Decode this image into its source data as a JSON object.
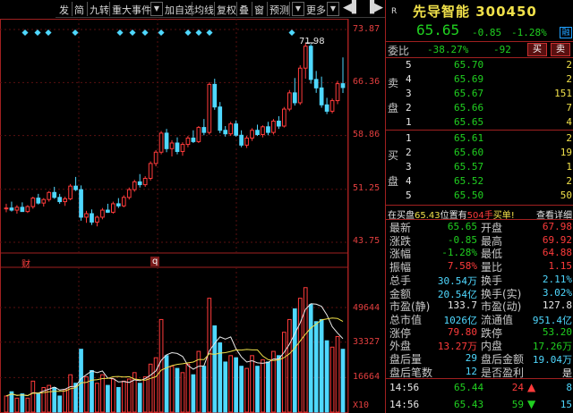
{
  "toolbar": {
    "items": [
      "发",
      "简",
      "九转",
      "重大事件",
      "加自选",
      "均线",
      "复权",
      "叠",
      "窗",
      "预测",
      "更多"
    ]
  },
  "chart": {
    "price_axis": [
      "73.87",
      "66.36",
      "58.86",
      "51.25",
      "43.75"
    ],
    "volume_axis": [
      "49644",
      "33327",
      "16664",
      "X10"
    ],
    "peak_label": "71.98",
    "markers": [
      "财",
      "q"
    ]
  },
  "chart_data": {
    "type": "candlestick",
    "ohlc": [
      [
        48.5,
        49.2,
        48.0,
        48.6
      ],
      [
        48.6,
        49.5,
        48.1,
        48.3
      ],
      [
        48.3,
        49.0,
        47.8,
        48.7
      ],
      [
        48.7,
        49.4,
        48.2,
        48.1
      ],
      [
        48.1,
        49.0,
        47.9,
        48.8
      ],
      [
        48.8,
        50.2,
        48.5,
        50.0
      ],
      [
        50.0,
        50.6,
        49.1,
        49.3
      ],
      [
        49.3,
        50.0,
        48.8,
        49.8
      ],
      [
        49.8,
        51.0,
        49.5,
        50.8
      ],
      [
        50.8,
        51.6,
        49.9,
        50.1
      ],
      [
        50.1,
        50.6,
        49.2,
        49.5
      ],
      [
        49.5,
        50.2,
        48.9,
        49.9
      ],
      [
        49.9,
        52.0,
        49.7,
        51.7
      ],
      [
        51.7,
        53.0,
        51.0,
        51.2
      ],
      [
        51.2,
        51.8,
        46.8,
        47.3
      ],
      [
        47.3,
        48.2,
        46.5,
        47.8
      ],
      [
        47.8,
        48.4,
        46.2,
        46.6
      ],
      [
        46.6,
        47.5,
        46.0,
        47.3
      ],
      [
        47.3,
        48.6,
        47.0,
        48.3
      ],
      [
        48.3,
        49.2,
        47.9,
        48.0
      ],
      [
        48.0,
        49.5,
        47.8,
        49.2
      ],
      [
        49.2,
        50.0,
        48.6,
        48.9
      ],
      [
        48.9,
        50.4,
        48.7,
        50.1
      ],
      [
        50.1,
        51.5,
        49.8,
        51.2
      ],
      [
        51.2,
        52.6,
        50.9,
        52.3
      ],
      [
        52.3,
        53.4,
        51.5,
        51.9
      ],
      [
        51.9,
        53.1,
        51.6,
        52.8
      ],
      [
        52.8,
        55.2,
        52.5,
        54.9
      ],
      [
        54.9,
        56.8,
        54.5,
        56.5
      ],
      [
        56.5,
        59.5,
        56.2,
        59.2
      ],
      [
        59.2,
        59.8,
        56.5,
        57.0
      ],
      [
        57.0,
        58.2,
        55.9,
        57.8
      ],
      [
        57.8,
        58.6,
        56.2,
        56.6
      ],
      [
        56.6,
        57.9,
        56.0,
        57.6
      ],
      [
        57.6,
        58.8,
        57.2,
        58.5
      ],
      [
        58.5,
        59.6,
        57.8,
        58.0
      ],
      [
        58.0,
        60.2,
        57.8,
        60.0
      ],
      [
        60.0,
        61.2,
        58.9,
        59.3
      ],
      [
        59.3,
        66.4,
        59.0,
        66.1
      ],
      [
        66.1,
        66.9,
        62.5,
        62.9
      ],
      [
        62.9,
        63.6,
        59.2,
        59.6
      ],
      [
        59.6,
        60.2,
        58.7,
        59.1
      ],
      [
        59.1,
        60.8,
        58.8,
        60.5
      ],
      [
        60.5,
        61.0,
        58.7,
        58.9
      ],
      [
        58.9,
        59.6,
        57.2,
        57.5
      ],
      [
        57.5,
        58.8,
        57.1,
        58.5
      ],
      [
        58.5,
        59.9,
        58.1,
        59.6
      ],
      [
        59.6,
        60.4,
        58.8,
        59.0
      ],
      [
        59.0,
        60.3,
        58.6,
        60.1
      ],
      [
        60.1,
        60.8,
        58.9,
        59.3
      ],
      [
        59.3,
        61.2,
        59.0,
        60.9
      ],
      [
        60.9,
        61.6,
        59.8,
        60.2
      ],
      [
        60.2,
        62.9,
        60.0,
        62.6
      ],
      [
        62.6,
        65.3,
        62.3,
        64.9
      ],
      [
        64.9,
        67.0,
        63.1,
        63.5
      ],
      [
        63.5,
        68.8,
        63.2,
        68.4
      ],
      [
        68.4,
        71.98,
        66.9,
        71.5
      ],
      [
        71.5,
        71.8,
        66.2,
        66.8
      ],
      [
        66.8,
        68.0,
        64.9,
        65.6
      ],
      [
        65.6,
        67.2,
        62.8,
        63.2
      ],
      [
        63.2,
        64.2,
        61.9,
        62.3
      ],
      [
        62.3,
        64.1,
        62.0,
        63.8
      ],
      [
        63.8,
        66.6,
        63.3,
        66.2
      ],
      [
        66.2,
        69.92,
        64.88,
        65.65
      ]
    ],
    "volume": [
      8,
      10,
      7,
      9,
      7,
      15,
      9,
      12,
      13,
      12,
      8,
      11,
      18,
      14,
      30,
      17,
      20,
      14,
      18,
      13,
      16,
      12,
      15,
      16,
      19,
      14,
      17,
      23,
      26,
      44,
      27,
      22,
      21,
      19,
      23,
      18,
      29,
      22,
      54,
      41,
      33,
      24,
      27,
      26,
      22,
      21,
      27,
      22,
      25,
      24,
      29,
      27,
      38,
      44,
      49,
      54,
      59,
      51,
      43,
      44,
      34,
      31,
      36,
      30
    ],
    "ylim": [
      43.75,
      73.87
    ],
    "volume_ylim": [
      0,
      49644
    ]
  },
  "stock": {
    "name": "先导智能",
    "code": "300450",
    "r_mark": "R",
    "price": "65.65",
    "change": "-0.85",
    "change_pct": "-1.28%",
    "rong": "融"
  },
  "weibi": {
    "label": "委比",
    "ratio": "-38.27%",
    "diff": "-92",
    "buy_btn": "买",
    "sell_btn": "卖"
  },
  "sell_orders": [
    {
      "level": "5",
      "price": "65.70",
      "qty": "2"
    },
    {
      "level": "4",
      "price": "65.69",
      "qty": "2"
    },
    {
      "level": "3",
      "price": "65.67",
      "qty": "151"
    },
    {
      "level": "2",
      "price": "65.66",
      "qty": "7"
    },
    {
      "level": "1",
      "price": "65.65",
      "qty": "4"
    }
  ],
  "sell_side_label": [
    "卖",
    "盘"
  ],
  "buy_orders": [
    {
      "level": "1",
      "price": "65.61",
      "qty": "2"
    },
    {
      "level": "2",
      "price": "65.60",
      "qty": "19"
    },
    {
      "level": "3",
      "price": "65.57",
      "qty": "1"
    },
    {
      "level": "4",
      "price": "65.52",
      "qty": "2"
    },
    {
      "level": "5",
      "price": "65.50",
      "qty": "50"
    }
  ],
  "buy_side_label": [
    "买",
    "盘"
  ],
  "alert": {
    "text_prefix": "在买盘",
    "price": "65.43",
    "text_mid": "位置有",
    "qty": "504手",
    "text_suffix": "买单!",
    "detail_link": "查看详细"
  },
  "stats": [
    {
      "l1": "最新",
      "v1": "65.65",
      "c1": "c-green",
      "l2": "开盘",
      "v2": "67.98",
      "c2": "c-red"
    },
    {
      "l1": "涨跌",
      "v1": "-0.85",
      "c1": "c-green",
      "l2": "最高",
      "v2": "69.92",
      "c2": "c-red"
    },
    {
      "l1": "涨幅",
      "v1": "-1.28%",
      "c1": "c-green",
      "l2": "最低",
      "v2": "64.88",
      "c2": "c-red"
    },
    {
      "l1": "振幅",
      "v1": "7.58%",
      "c1": "c-red",
      "l2": "量比",
      "v2": "1.15",
      "c2": "c-red"
    },
    {
      "l1": "总手",
      "v1": "30.54万",
      "c1": "c-cyan",
      "l2": "换手",
      "v2": "2.11%",
      "c2": "c-cyan"
    },
    {
      "l1": "金额",
      "v1": "20.54亿",
      "c1": "c-cyan",
      "l2": "换手(实)",
      "v2": "3.02%",
      "c2": "c-cyan"
    },
    {
      "l1": "市盈(静)",
      "v1": "133.7",
      "c1": "c-white",
      "l2": "市盈(动)",
      "v2": "127.8",
      "c2": "c-white"
    },
    {
      "l1": "总市值",
      "v1": "1026亿",
      "c1": "c-cyan",
      "l2": "流通值",
      "v2": "951.4亿",
      "c2": "c-cyan"
    },
    {
      "l1": "涨停",
      "v1": "79.80",
      "c1": "c-red",
      "l2": "跌停",
      "v2": "53.20",
      "c2": "c-green"
    },
    {
      "l1": "外盘",
      "v1": "13.27万",
      "c1": "c-red",
      "l2": "内盘",
      "v2": "17.26万",
      "c2": "c-green"
    },
    {
      "l1": "盘后量",
      "v1": "29",
      "c1": "c-cyan",
      "l2": "盘后金额",
      "v2": "19.04万",
      "c2": "c-cyan"
    },
    {
      "l1": "盘后笔数",
      "v1": "12",
      "c1": "c-cyan",
      "l2": "是否盈利",
      "v2": "是",
      "c2": "c-white"
    }
  ],
  "trades": [
    {
      "time": "14:56",
      "price": "65.44",
      "qty": "24",
      "dir": "up",
      "count": "8"
    },
    {
      "time": "14:56",
      "price": "65.43",
      "qty": "59",
      "dir": "down",
      "count": "15"
    }
  ]
}
